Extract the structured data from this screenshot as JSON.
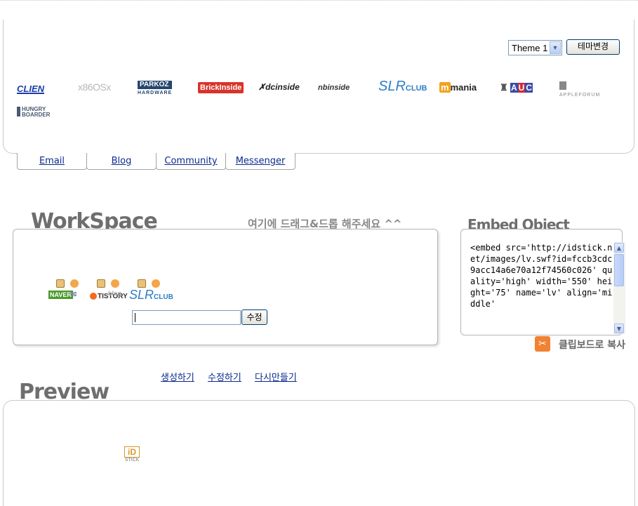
{
  "theme": {
    "select_value": "Theme 1",
    "button_label": "테마변경"
  },
  "logos": {
    "clien": "CLIEN",
    "x86": "x86OSx",
    "parkoz_main": "PARKOZ",
    "parkoz_sub": "HARDWARE",
    "brick": "BrickInside",
    "dc": "dcinside",
    "nb": "nbinside",
    "slr": "SLR",
    "slr_club": "CLUB",
    "mania_m": "m",
    "mania": "mania",
    "auc_a": "A",
    "auc_u": "U",
    "auc_c": "C",
    "apple": "APPLEFORUM",
    "hungry": "HUNGRY BOARDER"
  },
  "tabs": [
    {
      "label": "Email"
    },
    {
      "label": "Blog"
    },
    {
      "label": "Community"
    },
    {
      "label": "Messenger"
    }
  ],
  "workspace": {
    "title": "WorkSpace",
    "hint": "여기에 드래그&드롭 해주세요 ^^",
    "icons": {
      "naver": "NAVER",
      "tistory": "TISTORY",
      "blog": "blog",
      "slr": "SLR",
      "slr_club": "CLUB"
    },
    "input_value": "",
    "edit_button": "수정"
  },
  "embed": {
    "title": "Embed Object",
    "code": "<embed src='http://idstick.net/images/lv.swf?id=fccb3cdc9acc14a6e70a12f74560c026' quality='high' width='550' height='75' name='lv' align='middle'",
    "copy_label": "클립보드로 복사"
  },
  "actions": {
    "create": "생성하기",
    "edit": "수정하기",
    "remake": "다시만들기"
  },
  "preview": {
    "title": "Preview",
    "logo_id": "iD",
    "logo_text": "STICK"
  },
  "colors": {
    "link": "#0a2a8f",
    "title_gray": "#6e6e6e",
    "border": "#c9c9c9"
  }
}
